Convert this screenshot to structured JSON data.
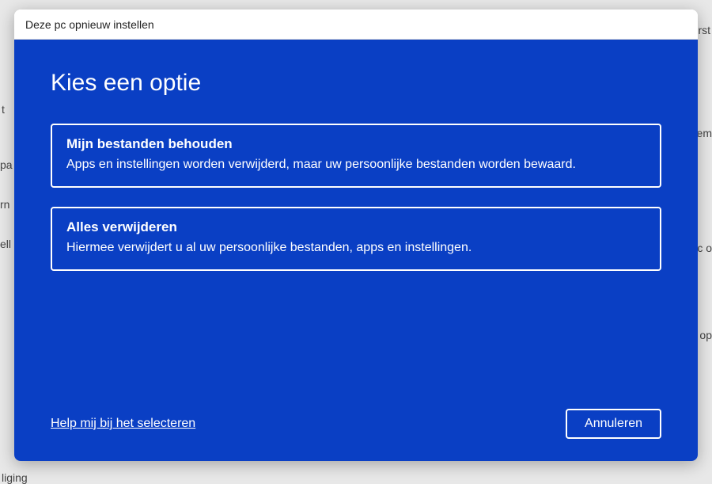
{
  "background": {
    "frag1": "t",
    "frag2": "pa",
    "frag3": "rn",
    "frag4": "ell",
    "frag5": "liging",
    "frag6": "erst",
    "frag7": "eem",
    "frag8": "Pc o",
    "frag9": "n op"
  },
  "dialog": {
    "title": "Deze pc opnieuw instellen",
    "heading": "Kies een optie",
    "options": [
      {
        "title": "Mijn bestanden behouden",
        "description": "Apps en instellingen worden verwijderd, maar uw persoonlijke bestanden worden bewaard."
      },
      {
        "title": "Alles verwijderen",
        "description": "Hiermee verwijdert u al uw persoonlijke bestanden, apps en instellingen."
      }
    ],
    "help_link": "Help mij bij het selecteren",
    "cancel": "Annuleren"
  }
}
